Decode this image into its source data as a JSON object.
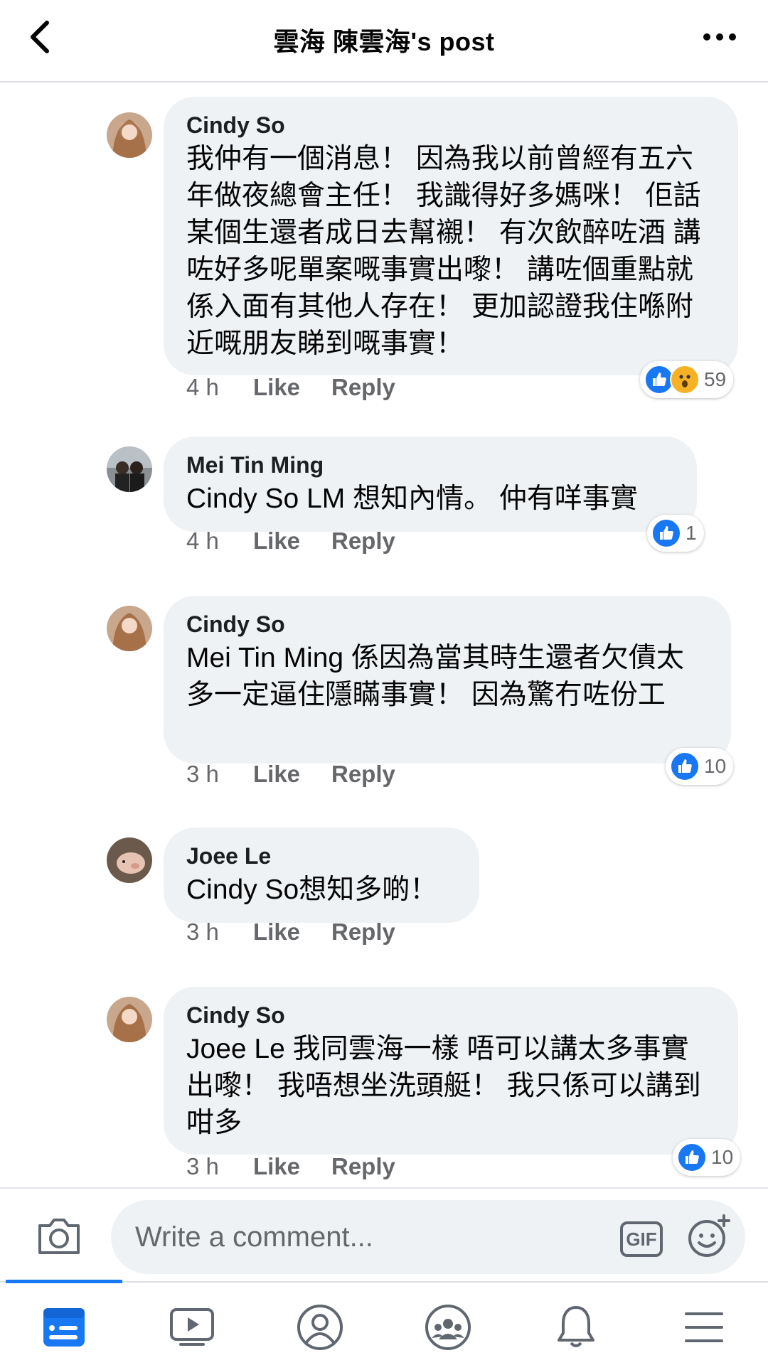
{
  "header": {
    "title": "雲海 陳雲海's post",
    "back_icon": "chevron-left-icon",
    "more_icon": "more-dots-icon"
  },
  "comments": [
    {
      "author": "Cindy So",
      "text": "我仲有一個消息！ 因為我以前曾經有五六年做夜總會主任！ 我識得好多媽咪！ 佢話某個生還者成日去幫襯！ 有次飲醉咗酒 講咗好多呢單案嘅事實出嚟！ 講咗個重點就係入面有其他人存在！ 更加認證我住喺附近嘅朋友睇到嘅事實！",
      "time": "4 h",
      "like_label": "Like",
      "reply_label": "Reply",
      "reactions": [
        "like",
        "wow"
      ],
      "reaction_count": "59"
    },
    {
      "author": "Mei Tin Ming",
      "text": "Cindy So LM 想知內情。 仲有咩事實",
      "time": "4 h",
      "like_label": "Like",
      "reply_label": "Reply",
      "reactions": [
        "like"
      ],
      "reaction_count": "1"
    },
    {
      "author": "Cindy So",
      "text": "Mei Tin Ming 係因為當其時生還者欠債太多一定逼住隱瞞事實！ 因為驚冇咗份工",
      "time": "3 h",
      "like_label": "Like",
      "reply_label": "Reply",
      "reactions": [
        "like"
      ],
      "reaction_count": "10"
    },
    {
      "author": "Joee Le",
      "text": "Cindy So想知多啲！",
      "time": "3 h",
      "like_label": "Like",
      "reply_label": "Reply",
      "reactions": [],
      "reaction_count": ""
    },
    {
      "author": "Cindy So",
      "text": "Joee Le 我同雲海一樣 唔可以講太多事實出嚟！ 我唔想坐洗頭艇！ 我只係可以講到咁多",
      "time": "3 h",
      "like_label": "Like",
      "reply_label": "Reply",
      "reactions": [
        "like"
      ],
      "reaction_count": "10"
    }
  ],
  "composer": {
    "placeholder": "Write a comment...",
    "camera_icon": "camera-icon",
    "gif_label": "GIF",
    "emoji_icon": "emoji-add-icon"
  },
  "bottom_nav": {
    "items": [
      "news-feed-icon",
      "watch-icon",
      "profile-icon",
      "groups-icon",
      "notifications-icon",
      "menu-icon"
    ],
    "active_index": 0,
    "active_color": "#1877f2"
  },
  "colors": {
    "bubble_bg": "#eff2f5",
    "meta_text": "#65676b",
    "like_blue": "#1877f2",
    "wow_yellow": "#f7b125"
  }
}
